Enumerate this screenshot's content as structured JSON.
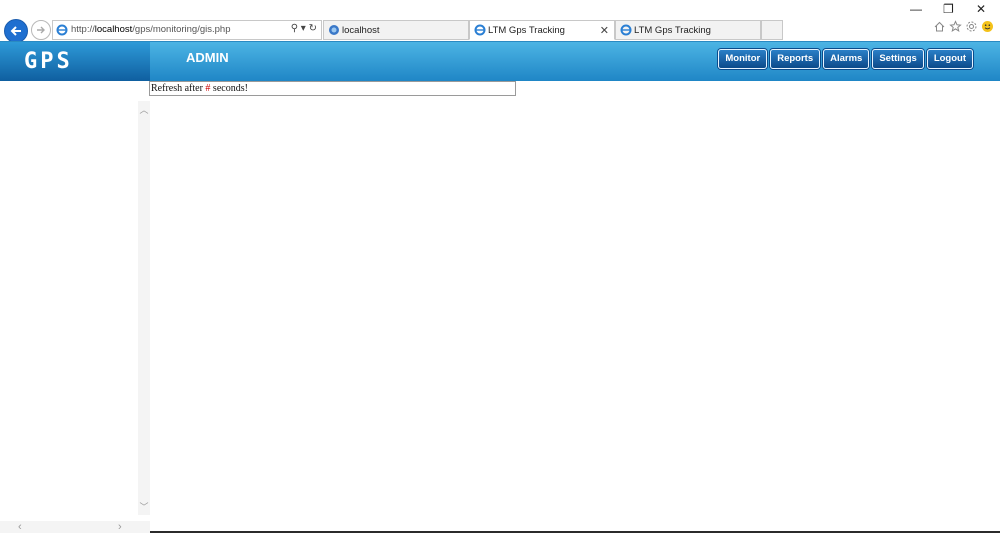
{
  "browser": {
    "url_prefix": "http://",
    "url_host": "localhost",
    "url_path": "/gps/monitoring/gis.php",
    "tabs": [
      {
        "label": "localhost",
        "active": false
      },
      {
        "label": "LTM Gps Tracking",
        "active": true
      },
      {
        "label": "LTM Gps Tracking",
        "active": false
      }
    ],
    "window_controls": {
      "minimize": "—",
      "restore": "❐",
      "close": "✕"
    },
    "toolbar_icons": [
      "home-icon",
      "favorites-star-icon",
      "settings-gear-icon",
      "smiley-feedback-icon"
    ]
  },
  "header": {
    "logo": "GPS",
    "user_role": "ADMIN",
    "nav": [
      "Monitor",
      "Reports",
      "Alarms",
      "Settings",
      "Logout"
    ]
  },
  "content": {
    "refresh_prefix": "Refresh after ",
    "refresh_count": "#",
    "refresh_suffix": " seconds!"
  },
  "colors": {
    "header_gradient_top": "#4cb4e4",
    "header_gradient_bottom": "#1f86c6",
    "nav_button": "#0c4a8a",
    "refresh_count": "#cc0000"
  }
}
